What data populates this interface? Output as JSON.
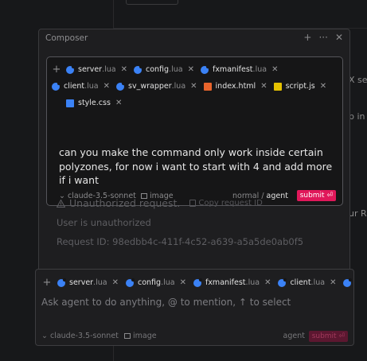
{
  "background": {
    "fragments": [
      "X se",
      "p in",
      "ur Ra"
    ]
  },
  "composer": {
    "title": "Composer",
    "header_icons": [
      "+",
      "···",
      "✕"
    ],
    "message": {
      "context_chips": [
        {
          "icon": "lua-file-icon",
          "name": "server",
          "ext": ".lua"
        },
        {
          "icon": "lua-file-icon",
          "name": "config",
          "ext": ".lua"
        },
        {
          "icon": "lua-file-icon",
          "name": "fxmanifest",
          "ext": ".lua"
        },
        {
          "icon": "lua-file-icon",
          "name": "client",
          "ext": ".lua"
        },
        {
          "icon": "lua-file-icon",
          "name": "sv_wrapper",
          "ext": ".lua"
        },
        {
          "icon": "html-file-icon",
          "name": "index.html",
          "ext": ""
        },
        {
          "icon": "js-file-icon",
          "name": "script.js",
          "ext": ""
        },
        {
          "icon": "css-file-icon",
          "name": "style.css",
          "ext": ""
        }
      ],
      "text": "can you make the command only work inside certain polyzones, for now i want to start with 4 and add more if i want",
      "model": "⌄ claude-3.5-sonnet",
      "image_label": "image",
      "mode_normal": "normal",
      "mode_sep": "/",
      "mode_agent": "agent",
      "submit_label": "submit ⏎"
    },
    "error": {
      "title": "Unauthorized request.",
      "copy_label": "Copy request ID",
      "detail": "User is unauthorized",
      "request_id": "Request ID: 98edbb4c-411f-4c52-a639-a5a5de0ab0f5"
    }
  },
  "input": {
    "context_chips": [
      {
        "icon": "lua-file-icon",
        "name": "server",
        "ext": ".lua"
      },
      {
        "icon": "lua-file-icon",
        "name": "config",
        "ext": ".lua"
      },
      {
        "icon": "lua-file-icon",
        "name": "fxmanifest",
        "ext": ".lua"
      },
      {
        "icon": "lua-file-icon",
        "name": "client",
        "ext": ".lua"
      }
    ],
    "placeholder": "Ask agent to do anything, @ to mention, ↑ to select",
    "model": "⌄ claude-3.5-sonnet",
    "image_label": "image",
    "mode": "agent",
    "submit_label": "submit ⏎"
  },
  "colors": {
    "accent": "#e0185a",
    "lua": "#3b82f6",
    "html": "#e8642c",
    "js": "#e5c100"
  }
}
